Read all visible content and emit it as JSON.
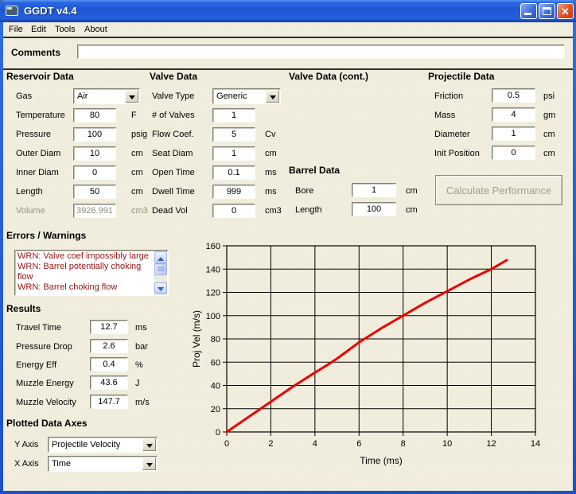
{
  "window": {
    "title": "GGDT v4.4"
  },
  "menu": {
    "items": [
      "File",
      "Edit",
      "Tools",
      "About"
    ]
  },
  "comments": {
    "label": "Comments",
    "value": ""
  },
  "reservoir": {
    "title": "Reservoir Data",
    "gas": {
      "label": "Gas",
      "value": "Air"
    },
    "temperature": {
      "label": "Temperature",
      "value": "80",
      "unit": "F"
    },
    "pressure": {
      "label": "Pressure",
      "value": "100",
      "unit": "psig"
    },
    "outer_diam": {
      "label": "Outer Diam",
      "value": "10",
      "unit": "cm"
    },
    "inner_diam": {
      "label": "Inner Diam",
      "value": "0",
      "unit": "cm"
    },
    "length": {
      "label": "Length",
      "value": "50",
      "unit": "cm"
    },
    "volume": {
      "label": "Volume",
      "value": "3926.991",
      "unit": "cm3"
    }
  },
  "valve": {
    "title": "Valve Data",
    "valve_type": {
      "label": "Valve Type",
      "value": "Generic"
    },
    "num_valves": {
      "label": "# of Valves",
      "value": "1"
    },
    "flow_coef": {
      "label": "Flow Coef.",
      "value": "5",
      "unit": "Cv"
    },
    "seat_diam": {
      "label": "Seat Diam",
      "value": "1",
      "unit": "cm"
    },
    "open_time": {
      "label": "Open Time",
      "value": "0.1",
      "unit": "ms"
    },
    "dwell_time": {
      "label": "Dwell Time",
      "value": "999",
      "unit": "ms"
    },
    "dead_vol": {
      "label": "Dead Vol",
      "value": "0",
      "unit": "cm3"
    }
  },
  "valve_cont": {
    "title": "Valve Data (cont.)"
  },
  "barrel": {
    "title": "Barrel Data",
    "bore": {
      "label": "Bore",
      "value": "1",
      "unit": "cm"
    },
    "length": {
      "label": "Length",
      "value": "100",
      "unit": "cm"
    }
  },
  "projectile": {
    "title": "Projectile Data",
    "friction": {
      "label": "Friction",
      "value": "0.5",
      "unit": "psi"
    },
    "mass": {
      "label": "Mass",
      "value": "4",
      "unit": "gm"
    },
    "diameter": {
      "label": "Diameter",
      "value": "1",
      "unit": "cm"
    },
    "init_position": {
      "label": "Init Position",
      "value": "0",
      "unit": "cm"
    },
    "calculate_label": "Calculate Performance"
  },
  "errors": {
    "title": "Errors / Warnings",
    "lines": [
      "WRN: Valve coef impossibly large",
      "WRN: Barrel potentially choking flow",
      "WRN: Barrel choking flow"
    ]
  },
  "results": {
    "title": "Results",
    "travel_time": {
      "label": "Travel Time",
      "value": "12.7",
      "unit": "ms"
    },
    "pressure_drop": {
      "label": "Pressure Drop",
      "value": "2.6",
      "unit": "bar"
    },
    "energy_eff": {
      "label": "Energy Eff",
      "value": "0.4",
      "unit": "%"
    },
    "muzzle_energy": {
      "label": "Muzzle Energy",
      "value": "43.6",
      "unit": "J"
    },
    "muzzle_velocity": {
      "label": "Muzzle Velocity",
      "value": "147.7",
      "unit": "m/s"
    }
  },
  "plotted_axes": {
    "title": "Plotted Data Axes",
    "y_axis": {
      "label": "Y Axis",
      "value": "Projectile Velocity"
    },
    "x_axis": {
      "label": "X Axis",
      "value": "Time"
    }
  },
  "colors": {
    "titlebar_blue": "#1f56d4",
    "error_text": "#9b1313",
    "curve_red": "#ee0000",
    "close_button_red": "#dd5022"
  },
  "chart_data": {
    "type": "line",
    "title": "",
    "xlabel": "Time (ms)",
    "ylabel": "Proj Vel (m/s)",
    "xlim": [
      0,
      14
    ],
    "ylim": [
      0,
      160
    ],
    "xtick_step": 2,
    "ytick_step": 20,
    "grid": true,
    "legend": "none",
    "series": [
      {
        "name": "Projectile Velocity",
        "color": "#ee0000",
        "x": [
          0,
          1,
          2,
          3,
          4,
          4.6,
          5,
          6,
          7,
          8,
          9,
          10,
          11,
          12,
          12.7
        ],
        "y": [
          0,
          13,
          26,
          39,
          51,
          58,
          63,
          77,
          89,
          100,
          111,
          121,
          131,
          140,
          147.7
        ]
      }
    ]
  }
}
